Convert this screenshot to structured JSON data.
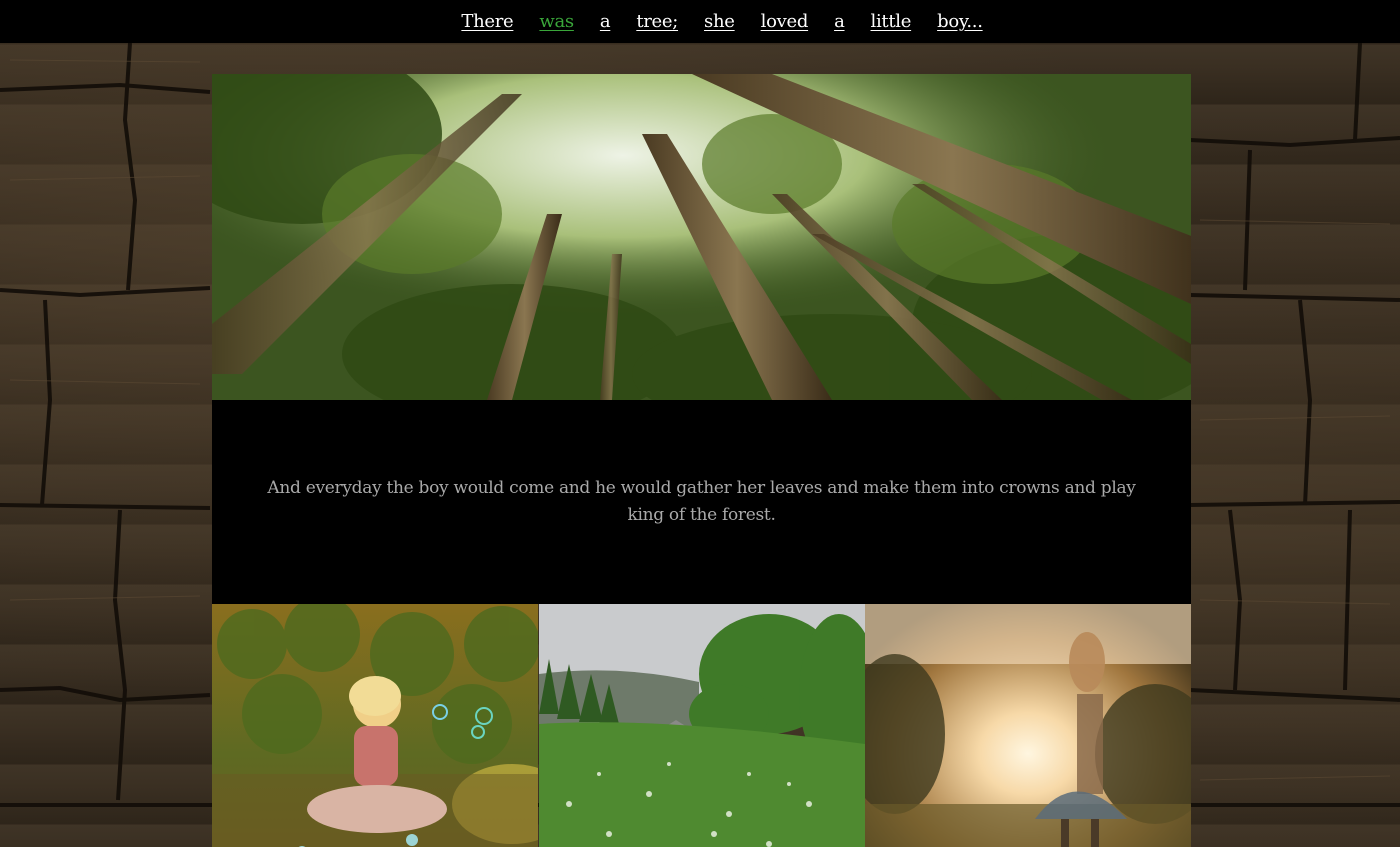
{
  "nav": {
    "items": [
      {
        "label": "There",
        "active": false
      },
      {
        "label": "was",
        "active": true
      },
      {
        "label": "a",
        "active": false
      },
      {
        "label": "tree;",
        "active": false
      },
      {
        "label": "she",
        "active": false
      },
      {
        "label": "loved",
        "active": false
      },
      {
        "label": "a",
        "active": false
      },
      {
        "label": "little",
        "active": false
      },
      {
        "label": "boy...",
        "active": false
      }
    ],
    "active_color": "#3aa63a"
  },
  "main": {
    "caption": "And everyday the boy would come and he would gather her leaves and make them into crowns and play king of the forest."
  },
  "gallery": {
    "images": [
      "girl-blowing-bubbles-photo",
      "meadow-cabin-photo",
      "girl-sunset-field-photo"
    ]
  },
  "colors": {
    "nav_bg": "#000000",
    "caption_bg": "#000000",
    "caption_text": "#a9a9a9"
  }
}
